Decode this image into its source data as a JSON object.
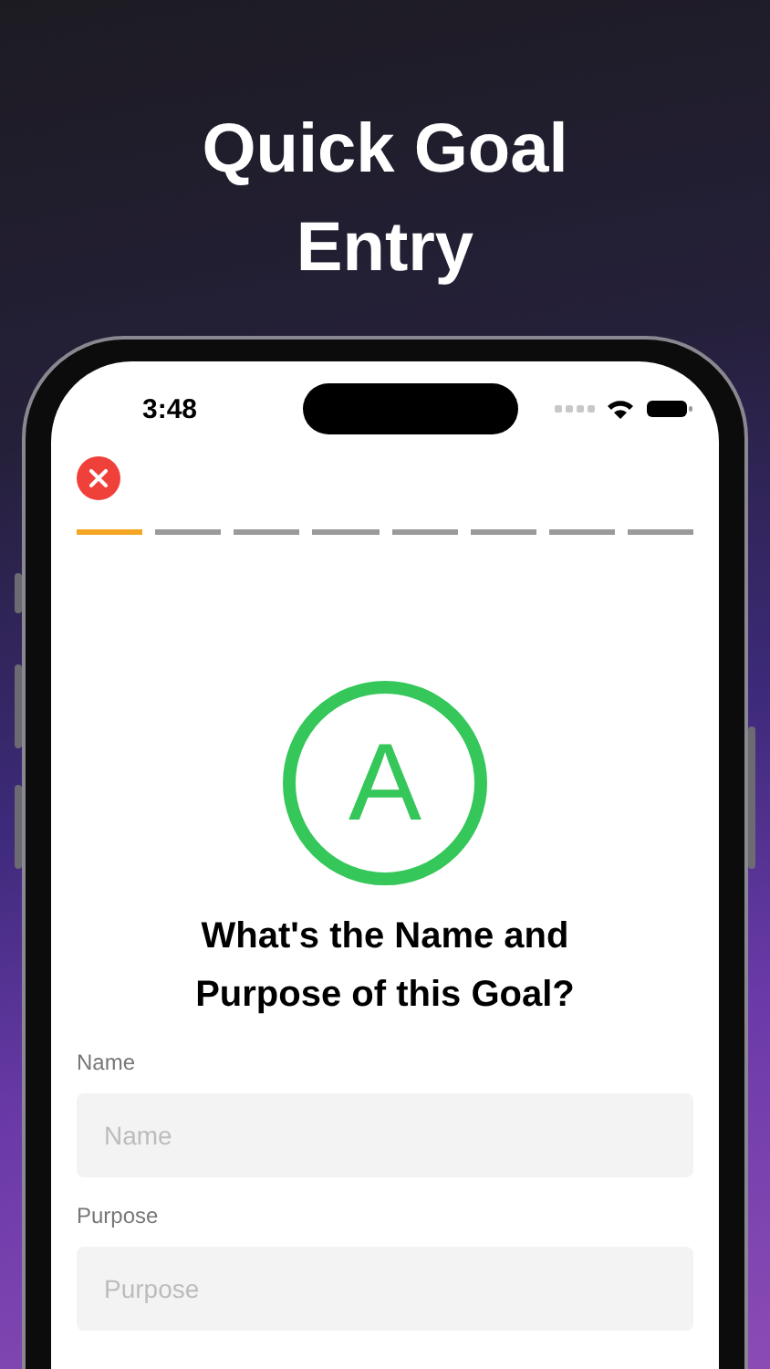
{
  "headline": "Quick Goal Entry",
  "status_bar": {
    "time": "3:48"
  },
  "progress_steps": [
    {
      "selected": true
    },
    {
      "selected": false
    },
    {
      "selected": false
    },
    {
      "selected": false
    },
    {
      "selected": false
    },
    {
      "selected": false
    },
    {
      "selected": false
    },
    {
      "selected": false
    }
  ],
  "badge_letter": "A",
  "question": "What's the Name and Purpose of this Goal?",
  "fields": [
    {
      "label": "Name",
      "placeholder": "Name"
    },
    {
      "label": "Purpose",
      "placeholder": "Purpose"
    }
  ]
}
